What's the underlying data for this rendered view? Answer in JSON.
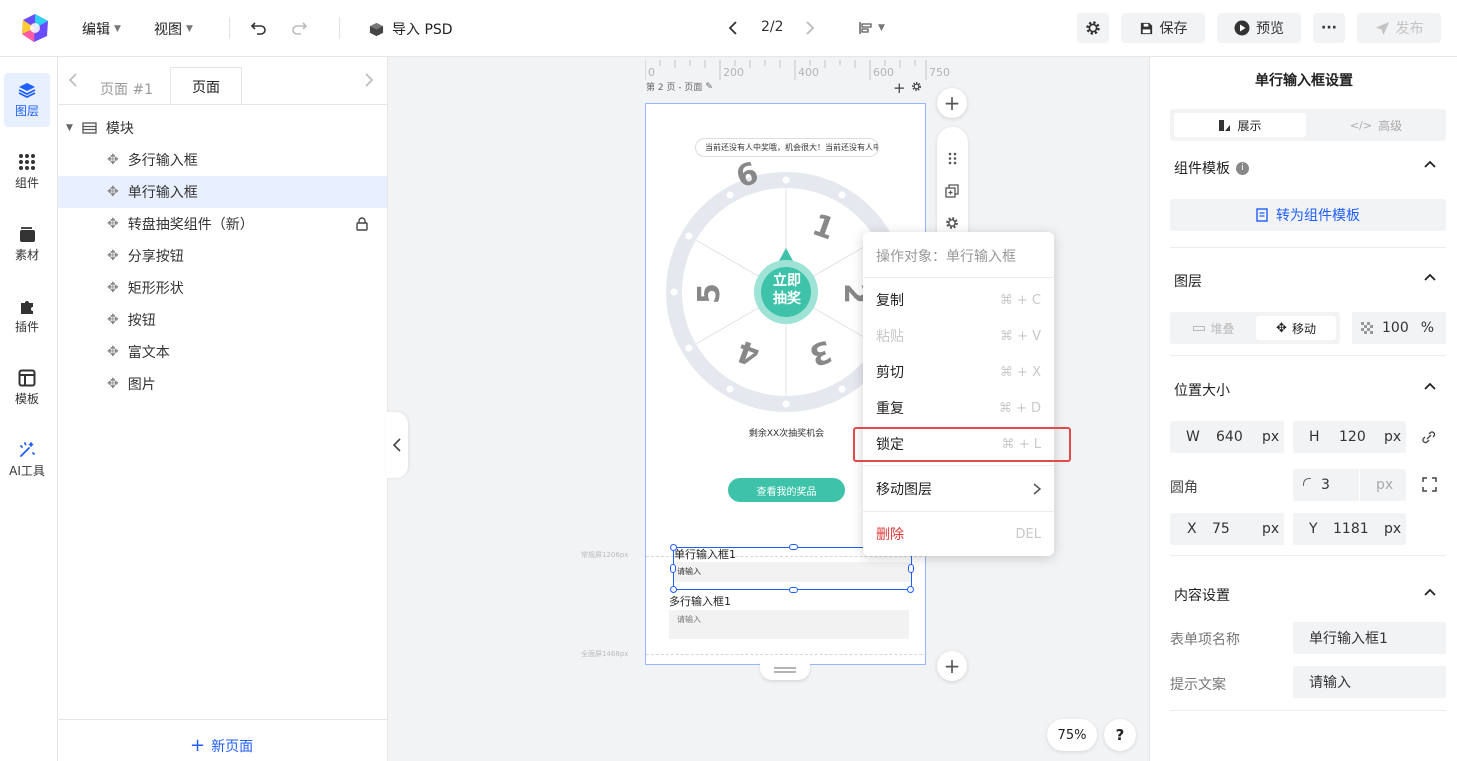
{
  "topbar": {
    "menu_edit": "编辑",
    "menu_view": "视图",
    "import_psd": "导入 PSD",
    "page_indicator": "2/2",
    "save": "保存",
    "preview": "预览",
    "publish": "发布"
  },
  "leftnav": [
    {
      "label": "图层",
      "icon": "layers-icon"
    },
    {
      "label": "组件",
      "icon": "grid-icon"
    },
    {
      "label": "素材",
      "icon": "assets-icon"
    },
    {
      "label": "插件",
      "icon": "puzzle-icon"
    },
    {
      "label": "模板",
      "icon": "template-icon"
    },
    {
      "label": "AI工具",
      "icon": "sparkle-icon"
    }
  ],
  "layers_panel": {
    "tab_prev": "页面 #1",
    "tab_active": "页面",
    "group": "模块",
    "items": [
      "多行输入框",
      "单行输入框",
      "转盘抽奖组件（新）",
      "分享按钮",
      "矩形形状",
      "按钮",
      "富文本",
      "图片"
    ],
    "new_page": "新页面"
  },
  "canvas": {
    "ruler_labels": [
      "0",
      "200",
      "400",
      "600",
      "750"
    ],
    "page_label": "第 2 页 - 页面",
    "marquee": "当前还没有人中奖哦，机会很大！当前还没有人中奖哦",
    "wheel_numbers": [
      "1",
      "2",
      "3",
      "4",
      "5",
      "6"
    ],
    "wheel_center": [
      "立即",
      "抽奖"
    ],
    "remaining": "剩余XX次抽奖机会",
    "prize_button": "查看我的奖品",
    "single_input_label": "单行输入框1",
    "single_input_placeholder": "请输入",
    "multi_input_label": "多行输入框1",
    "multi_input_placeholder": "请输入",
    "guide_normal": "常规屏1206px",
    "guide_full": "全面屏1468px",
    "zoom": "75%",
    "help": "?"
  },
  "context_menu": {
    "header": "操作对象：单行输入框",
    "items": [
      {
        "label": "复制",
        "shortcut": "⌘ + C",
        "disabled": false
      },
      {
        "label": "粘贴",
        "shortcut": "⌘ + V",
        "disabled": true
      },
      {
        "label": "剪切",
        "shortcut": "⌘ + X",
        "disabled": false
      },
      {
        "label": "重复",
        "shortcut": "⌘ + D",
        "disabled": false
      },
      {
        "label": "锁定",
        "shortcut": "⌘ + L",
        "disabled": false
      }
    ],
    "move_layer": "移动图层",
    "delete": "删除",
    "delete_shortcut": "DEL"
  },
  "right_panel": {
    "title": "单行输入框设置",
    "tab_display": "展示",
    "tab_advanced": "高级",
    "template_section": "组件模板",
    "convert_template": "转为组件模板",
    "layer_section": "图层",
    "stack": "堆叠",
    "move": "移动",
    "opacity": "100",
    "opacity_unit": "%",
    "position_section": "位置大小",
    "w_label": "W",
    "w_value": "640",
    "h_label": "H",
    "h_value": "120",
    "radius_label": "圆角",
    "radius_value": "3",
    "x_label": "X",
    "x_value": "75",
    "y_label": "Y",
    "y_value": "1181",
    "unit": "px",
    "content_section": "内容设置",
    "form_name_label": "表单项名称",
    "form_name_value": "单行输入框1",
    "hint_label": "提示文案",
    "hint_value": "请输入"
  },
  "colors": {
    "accent": "#1f5eff",
    "teal": "#3ec3aa",
    "danger": "#e5393a"
  }
}
